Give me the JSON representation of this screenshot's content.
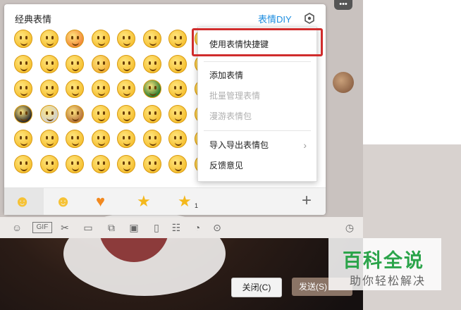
{
  "panel": {
    "title": "经典表情",
    "diy_label": "表情DIY"
  },
  "menu": {
    "items": [
      {
        "label": "使用表情快捷键",
        "enabled": true
      },
      {
        "label": "添加表情",
        "enabled": true
      },
      {
        "label": "批量管理表情",
        "enabled": false
      },
      {
        "label": "漫游表情包",
        "enabled": false
      },
      {
        "label": "导入导出表情包",
        "enabled": true,
        "submenu": true
      },
      {
        "label": "反馈意见",
        "enabled": true
      }
    ]
  },
  "emoji_tabs": [
    "smiley-face",
    "grinning-face",
    "heart",
    "star",
    "star-1"
  ],
  "emoji_tab_badge": "1",
  "add_tab_label": "+",
  "buttons": {
    "close_label": "关闭(C)",
    "send_label": "发送(S)"
  },
  "toolbar": {
    "icons": [
      "smiley-icon",
      "gif-icon",
      "scissors-icon",
      "folder-icon",
      "screenshot-icon",
      "image-icon",
      "phone-icon",
      "video-icon",
      "calendar-icon",
      "music-icon",
      "more-icon",
      "history-icon"
    ],
    "gif_label": "GIF"
  },
  "watermark": {
    "title": "百科全说",
    "subtitle": "助你轻松解决"
  },
  "colors": {
    "accent_blue": "#1e8ee0",
    "highlight_red": "#d02c2c",
    "emoji_yellow": "#f6c235",
    "watermark_green": "#2ba44a"
  }
}
